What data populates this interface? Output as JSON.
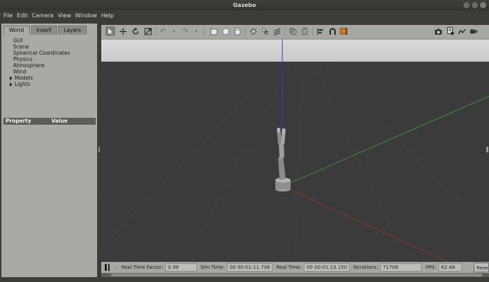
{
  "window": {
    "title": "Gazebo"
  },
  "menu": [
    "File",
    "Edit",
    "Camera",
    "View",
    "Window",
    "Help"
  ],
  "left_panel": {
    "tabs": [
      "World",
      "Insert",
      "Layers"
    ],
    "tree": [
      "GUI",
      "Scene",
      "Spherical Coordinates",
      "Physics",
      "Atmosphere",
      "Wind"
    ],
    "expandable": [
      "Models",
      "Lights"
    ],
    "property_columns": [
      "Property",
      "Value"
    ]
  },
  "toolbar_icons": [
    "select-arrow-icon",
    "translate-icon",
    "rotate-icon",
    "scale-icon",
    "undo-icon",
    "undo-dropdown-icon",
    "redo-icon",
    "redo-dropdown-icon",
    "box-icon",
    "sphere-icon",
    "cylinder-icon",
    "point-light-icon",
    "spot-light-icon",
    "directional-light-icon",
    "copy-icon",
    "paste-icon",
    "align-icon",
    "snap-icon",
    "view-angle-icon",
    "screenshot-icon",
    "log-icon",
    "plot-icon",
    "video-icon"
  ],
  "status": {
    "real_time_factor_label": "Real Time Factor:",
    "real_time_factor": "0.99",
    "sim_time_label": "Sim Time:",
    "sim_time": "00 00:01:11.708",
    "real_time_label": "Real Time:",
    "real_time": "00 00:01:13.150",
    "iterations_label": "Iterations:",
    "iterations": "71708",
    "fps_label": "FPS:",
    "fps": "62.48",
    "reset_label": "Reset"
  },
  "colors": {
    "x_axis": "#b04040",
    "y_axis": "#3f8f3f",
    "z_axis": "#3a3ad0",
    "sky": "#d2d2d2",
    "ground": "#3a3a3a"
  }
}
